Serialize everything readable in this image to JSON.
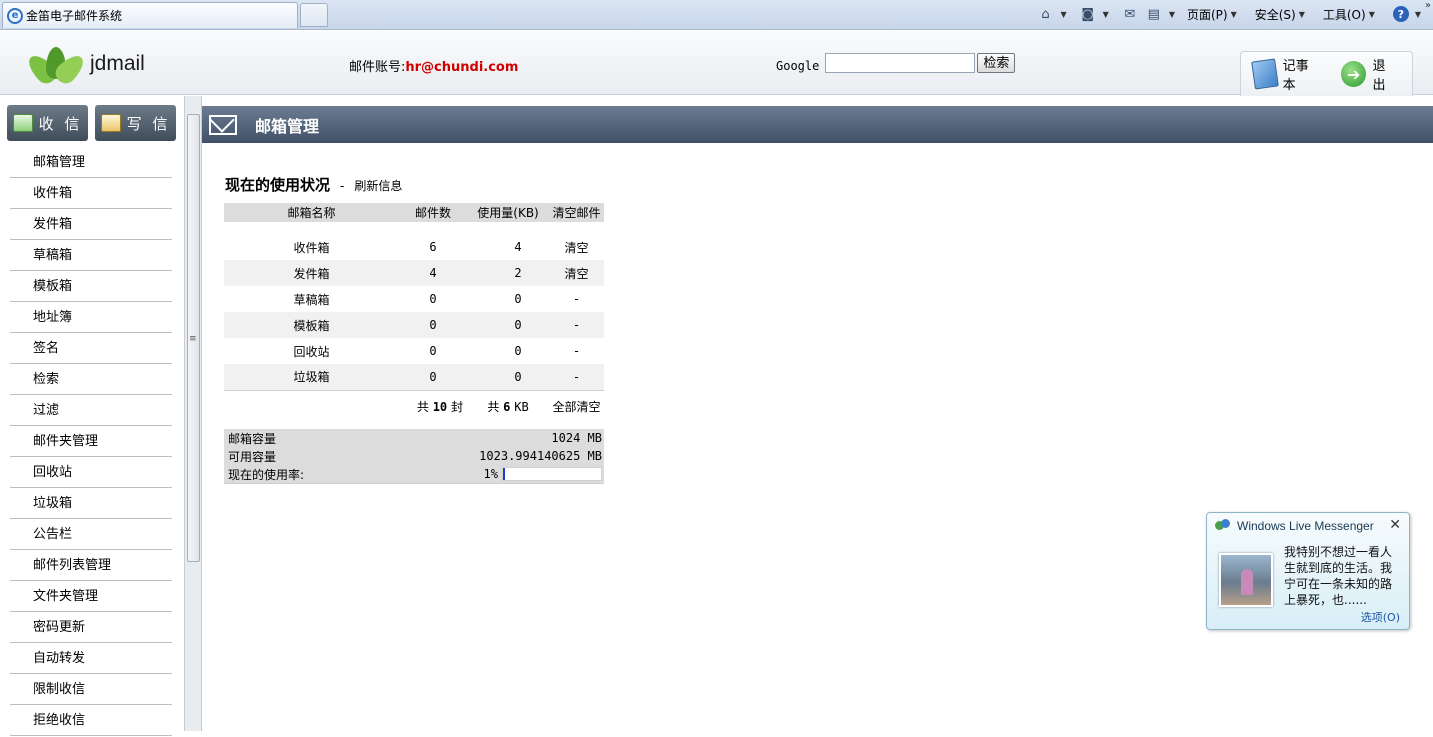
{
  "browser": {
    "tab_title": "金笛电子邮件系统",
    "menu_page": "页面(P)",
    "menu_safety": "安全(S)",
    "menu_tools": "工具(O)",
    "help_glyph": "?",
    "more_glyph": "»",
    "icons": [
      "home-icon",
      "feeds-icon",
      "read-mail-icon",
      "print-icon",
      "help-icon"
    ]
  },
  "header": {
    "app_name": "jdmail",
    "account_label": "邮件账号:",
    "account_value": "hr@chundi.com",
    "google_label": "Google",
    "google_query": "",
    "search_button": "检索",
    "notepad_label": "记事本",
    "exit_label": "退出",
    "exit_glyph": "➔"
  },
  "sidebar": {
    "receive_label": "收 信",
    "compose_label": "写 信",
    "items": [
      {
        "label": "邮箱管理"
      },
      {
        "label": "收件箱"
      },
      {
        "label": "发件箱"
      },
      {
        "label": "草稿箱"
      },
      {
        "label": "模板箱"
      },
      {
        "label": "地址簿"
      },
      {
        "label": "签名"
      },
      {
        "label": "检索"
      },
      {
        "label": "过滤"
      },
      {
        "label": "邮件夹管理"
      },
      {
        "label": "回收站"
      },
      {
        "label": "垃圾箱"
      },
      {
        "label": "公告栏"
      },
      {
        "label": "邮件列表管理"
      },
      {
        "label": "文件夹管理"
      },
      {
        "label": "密码更新"
      },
      {
        "label": "自动转发"
      },
      {
        "label": "限制收信"
      },
      {
        "label": "拒绝收信"
      }
    ]
  },
  "main": {
    "title": "邮箱管理",
    "usage_title": "现在的使用状况",
    "separator": "-",
    "refresh_label": "刷新信息",
    "table": {
      "headers": [
        "邮箱名称",
        "邮件数",
        "使用量(KB)",
        "清空邮件"
      ],
      "rows": [
        {
          "name": "收件箱",
          "count": "6",
          "size": "4",
          "action": "清空"
        },
        {
          "name": "发件箱",
          "count": "4",
          "size": "2",
          "action": "清空"
        },
        {
          "name": "草稿箱",
          "count": "0",
          "size": "0",
          "action": "-"
        },
        {
          "name": "模板箱",
          "count": "0",
          "size": "0",
          "action": "-"
        },
        {
          "name": "回收站",
          "count": "0",
          "size": "0",
          "action": "-"
        },
        {
          "name": "垃圾箱",
          "count": "0",
          "size": "0",
          "action": "-"
        }
      ],
      "total_prefix": "共",
      "total_count": "10",
      "total_count_unit": "封",
      "total_size": "6",
      "total_size_unit": "KB",
      "clear_all": "全部清空"
    },
    "capacity": {
      "capacity_label": "邮箱容量",
      "capacity_value": "1024 MB",
      "available_label": "可用容量",
      "available_value": "1023.994140625 MB",
      "rate_label": "现在的使用率:",
      "rate_value": "1%",
      "rate_fraction": 0.01
    }
  },
  "messenger": {
    "title": "Windows Live Messenger",
    "close_glyph": "✕",
    "message": "我特别不想过一看人生就到底的生活。我宁可在一条未知的路上暴死，也......",
    "options_label": "选项(O)"
  }
}
